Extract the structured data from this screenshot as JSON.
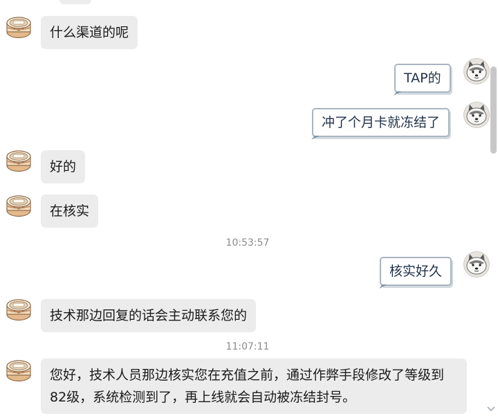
{
  "messages": {
    "m0": "什么渠道的呢",
    "m1": "TAP的",
    "m2": "冲了个月卡就冻结了",
    "m3": "好的",
    "m4": "在核实",
    "m5": "核实好久",
    "m6": "技术那边回复的话会主动联系您的",
    "m7": "您好，技术人员那边核实您在充值之前，通过作弊手段修改了等级到82级，系统检测到了，再上线就会自动被冻结封号。"
  },
  "timestamps": {
    "t1": "10:53:57",
    "t2": "11:07:11"
  },
  "icons": {
    "agent_avatar": "canned-food-avatar-icon",
    "user_avatar": "husky-dog-avatar-icon",
    "scroll_down": "chevron-down-icon"
  },
  "colors": {
    "incoming_bubble": "#ececec",
    "outgoing_border": "#a9b4bf",
    "outgoing_text": "#1f3049",
    "timestamp": "#8b8b8b"
  }
}
